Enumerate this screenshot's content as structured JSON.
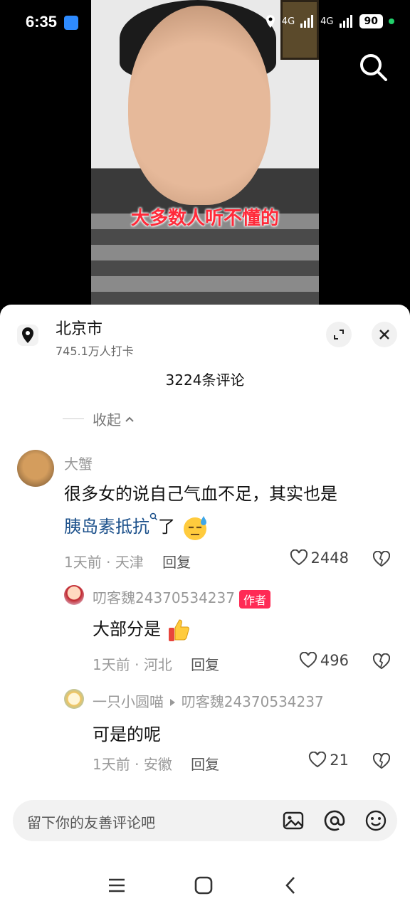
{
  "status": {
    "time": "6:35",
    "network1": "4G",
    "network2": "4G",
    "battery": "90"
  },
  "video": {
    "subtitle": "大多数人听不懂的"
  },
  "location": {
    "name": "北京市",
    "checkins": "745.1万人打卡"
  },
  "comments_header": {
    "count": "3224条评论",
    "collapse_label": "收起"
  },
  "comments": [
    {
      "user": "大蟹",
      "text_line1": "很多女的说自己气血不足，其实也是",
      "text_line2_link": "胰岛素抵抗",
      "text_line2_rest": "了",
      "time": "1天前",
      "place": "天津",
      "reply_label": "回复",
      "likes": "2448"
    },
    {
      "user": "叨客魏24370534237",
      "badge": "作者",
      "text": "大部分是",
      "time": "1天前",
      "place": "河北",
      "reply_label": "回复",
      "likes": "496"
    },
    {
      "user": "一只小圆喵",
      "reply_to": "叨客魏24370534237",
      "text": "可是的呢",
      "time": "1天前",
      "place": "安徽",
      "reply_label": "回复",
      "likes": "21"
    }
  ],
  "input": {
    "placeholder": "留下你的友善评论吧"
  },
  "colors": {
    "accent": "#ff2a55",
    "link": "#1a4f8a",
    "subtitle": "#ff2a3a"
  }
}
